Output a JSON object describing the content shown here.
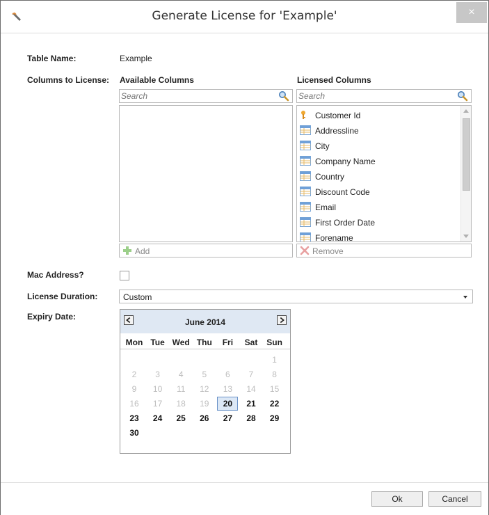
{
  "window": {
    "title": "Generate License for 'Example'",
    "close_glyph": "×",
    "app_icon": "wrench-icon"
  },
  "form": {
    "table_name_label": "Table Name:",
    "table_name_value": "Example",
    "columns_label": "Columns to License:",
    "available": {
      "header": "Available Columns",
      "search_placeholder": "Search",
      "items": [],
      "action_label": "Add"
    },
    "licensed": {
      "header": "Licensed Columns",
      "search_placeholder": "Search",
      "items": [
        {
          "label": "Customer Id",
          "icon": "key-icon"
        },
        {
          "label": "Addressline",
          "icon": "column-icon"
        },
        {
          "label": "City",
          "icon": "column-icon"
        },
        {
          "label": "Company Name",
          "icon": "column-icon"
        },
        {
          "label": "Country",
          "icon": "column-icon"
        },
        {
          "label": "Discount Code",
          "icon": "column-icon"
        },
        {
          "label": "Email",
          "icon": "column-icon"
        },
        {
          "label": "First Order Date",
          "icon": "column-icon"
        },
        {
          "label": "Forename",
          "icon": "column-icon"
        }
      ],
      "action_label": "Remove"
    },
    "mac_address_label": "Mac Address?",
    "mac_address_checked": false,
    "license_duration_label": "License Duration:",
    "license_duration_value": "Custom",
    "expiry_date_label": "Expiry Date:"
  },
  "calendar": {
    "month": "June 2014",
    "prev_glyph": "<",
    "next_glyph": ">",
    "weekdays": [
      "Mon",
      "Tue",
      "Wed",
      "Thu",
      "Fri",
      "Sat",
      "Sun"
    ],
    "first_weekday_index": 6,
    "days_in_month": 30,
    "selected_day": 20,
    "min_selectable_day": 20
  },
  "footer": {
    "ok_label": "Ok",
    "cancel_label": "Cancel"
  }
}
